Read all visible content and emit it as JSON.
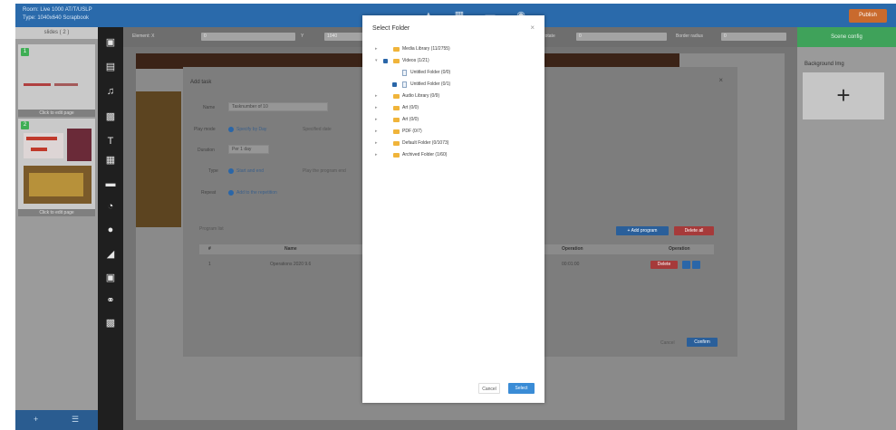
{
  "topbar": {
    "info_line1": "Room: Live 1000 AT/T/USLP",
    "info_line2": "Type: 1040x640 Scrapbook",
    "icons": [
      "hanger-icon",
      "grid-icon",
      "trash-icon",
      "eye-icon"
    ],
    "publish_label": "Publish"
  },
  "left_panel": {
    "header": "slides ( 2 )",
    "slides": [
      {
        "number": "1",
        "caption": "Click to edit page"
      },
      {
        "number": "2",
        "caption": "Click to edit page"
      }
    ],
    "footer_left": "+",
    "footer_right": "☰"
  },
  "toolbar": {
    "tools": [
      "image-icon",
      "film-icon",
      "music-icon",
      "crop-icon",
      "text-icon",
      "web-icon",
      "ticker-icon",
      "clock-icon",
      "weather-icon",
      "document-icon",
      "frame-icon",
      "link-icon",
      "table-icon"
    ]
  },
  "propbar": {
    "labels": [
      "Element: X",
      "Y",
      "Width",
      "Height",
      "Rotate",
      "Border radius"
    ],
    "values": [
      "0",
      "1040",
      "640",
      "0",
      "0",
      "0"
    ]
  },
  "right_panel": {
    "tab": "Scene config",
    "title": "Background Img",
    "add_symbol": "+"
  },
  "bg_dialog": {
    "title": "Add task",
    "close": "×",
    "name_label": "Name",
    "name_value": "Tasknumber of 10",
    "play_mode_label": "Play mode",
    "play_mode_option1": "Specify by Day",
    "play_mode_option2": "Specified date",
    "duration_label": "Duration",
    "duration_value": "Per 1 day",
    "type_label": "Type",
    "type_option": "Start and end",
    "type_extra": "Play the program end",
    "repeat_label": "Repeat",
    "repeat_option": "Add to the repetition",
    "program_list_label": "Program list",
    "add_program_btn": "+ Add program",
    "delete_all_btn": "Delete all",
    "table_headers": [
      "#",
      "Name",
      "Operation",
      "Operation"
    ],
    "row": {
      "index": "1",
      "name": "Operations 2020 9.6",
      "time": "00:01:00",
      "delete": "Delete"
    },
    "cancel": "Cancel",
    "confirm": "Confirm"
  },
  "folder_dialog": {
    "title": "Select Folder",
    "close": "×",
    "tree": [
      {
        "label": "Media Library (11/2755)",
        "level": 0,
        "kind": "folder",
        "checked": false
      },
      {
        "label": "Videos (1/21)",
        "level": 0,
        "kind": "folder",
        "checked": true,
        "expanded": true
      },
      {
        "label": "Untitled Folder (0/0)",
        "level": 1,
        "kind": "file",
        "checked": false
      },
      {
        "label": "Untitled Folder (0/1)",
        "level": 1,
        "kind": "file",
        "checked": true
      },
      {
        "label": "Audio Library (0/9)",
        "level": 0,
        "kind": "folder",
        "checked": false
      },
      {
        "label": "Art (0/0)",
        "level": 0,
        "kind": "folder",
        "checked": false
      },
      {
        "label": "Art (0/0)",
        "level": 0,
        "kind": "folder",
        "checked": false
      },
      {
        "label": "PDF (0/7)",
        "level": 0,
        "kind": "folder",
        "checked": false
      },
      {
        "label": "Default Folder (0/1073)",
        "level": 0,
        "kind": "folder",
        "checked": false
      },
      {
        "label": "Archived Folder (1/60)",
        "level": 0,
        "kind": "folder",
        "checked": false
      }
    ],
    "cancel": "Cancel",
    "ok": "Select"
  }
}
